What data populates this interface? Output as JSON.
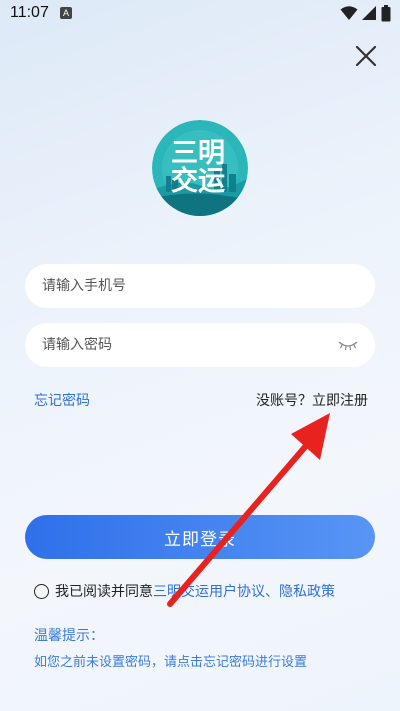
{
  "status_bar": {
    "time": "11:07",
    "notification_letter": "A"
  },
  "logo": {
    "text_line1": "三明",
    "text_line2": "交运",
    "colors": {
      "circle": "#29b3b8",
      "text": "#ffffff",
      "skyline": "#1a8f9a"
    }
  },
  "login_form": {
    "phone_placeholder": "请输入手机号",
    "password_placeholder": "请输入密码",
    "forgot_password": "忘记密码",
    "no_account": "没账号？",
    "register": "立即注册",
    "login_button": "立即登录"
  },
  "agreement": {
    "prefix": "我已阅读并同意",
    "user_agreement": "三明交运用户协议",
    "separator": "、",
    "privacy_policy": "隐私政策"
  },
  "tips": {
    "title": "温馨提示：",
    "text": "如您之前未设置密码，请点击忘记密码进行设置"
  },
  "colors": {
    "accent": "#2f6fd8",
    "button_gradient_start": "#2f70ea",
    "button_gradient_end": "#5895f5",
    "annotation_arrow": "#e8231f"
  },
  "icons": [
    "wifi-icon",
    "signal-icon",
    "battery-icon",
    "close-icon",
    "eye-closed-icon",
    "radio-unchecked-icon"
  ]
}
